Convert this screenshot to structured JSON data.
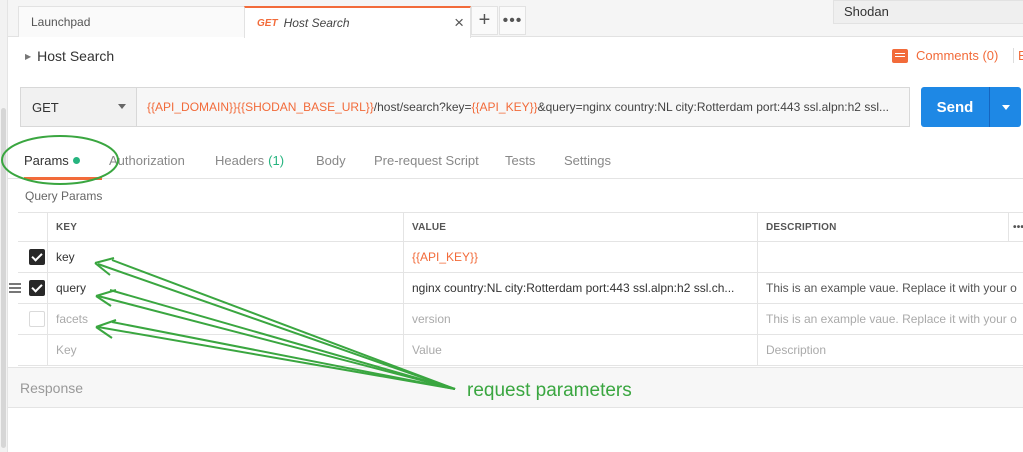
{
  "tabs": [
    {
      "label": "Launchpad"
    },
    {
      "method": "GET",
      "label": "Host Search",
      "close": "×"
    }
  ],
  "tab_actions": {
    "new": "+",
    "more": "•••"
  },
  "environment": {
    "selected": "Shodan"
  },
  "request": {
    "name": "Host Search",
    "comments_label": "Comments (0)",
    "edit_label": "E",
    "method": "GET",
    "url_parts": [
      {
        "text": "{{API_DOMAIN}}",
        "var": true
      },
      {
        "text": "{{SHODAN_BASE_URL}}",
        "var": true
      },
      {
        "text": "/host/search?key=",
        "var": false
      },
      {
        "text": "{{API_KEY}}",
        "var": true
      },
      {
        "text": "&query=nginx country:NL city:Rotterdam port:443 ssl.alpn:h2 ssl...",
        "var": false
      }
    ],
    "send_label": "Send"
  },
  "request_tabs": [
    {
      "label": "Params",
      "active": true,
      "dot": true
    },
    {
      "label": "Authorization"
    },
    {
      "label": "Headers",
      "count": "(1)"
    },
    {
      "label": "Body"
    },
    {
      "label": "Pre-request Script"
    },
    {
      "label": "Tests"
    },
    {
      "label": "Settings"
    }
  ],
  "params": {
    "section_title": "Query Params",
    "headers": {
      "key": "KEY",
      "value": "VALUE",
      "description": "DESCRIPTION",
      "more": "•••"
    },
    "rows": [
      {
        "checked": true,
        "key": "key",
        "value": "{{API_KEY}}",
        "description": ""
      },
      {
        "checked": true,
        "key": "query",
        "value": "nginx country:NL city:Rotterdam port:443 ssl.alpn:h2 ssl.ch...",
        "description": "This is an example vaue. Replace it with your o"
      },
      {
        "checked": false,
        "key": "facets",
        "value": "version",
        "description": "This is an example vaue. Replace it with your o"
      }
    ],
    "placeholders": {
      "key": "Key",
      "value": "Value",
      "description": "Description"
    }
  },
  "response": {
    "label": "Response"
  },
  "annotation": {
    "label": "request parameters",
    "color": "#3aa640"
  },
  "colors": {
    "accent": "#f26b3a",
    "send": "#1e88e5",
    "active_dot": "#26b47f"
  }
}
